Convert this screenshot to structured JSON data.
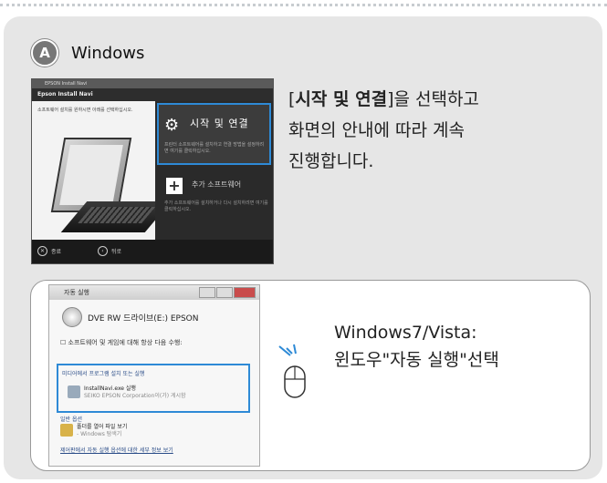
{
  "header": {
    "badge": "A",
    "title": "Windows"
  },
  "navi": {
    "window_title": "EPSON Install Navi",
    "app_title": "Epson Install Navi",
    "left_text": "소프트웨어 설치를 원하시면 아래를 선택하십시오.",
    "option1_label": "시작 및 연결",
    "option1_desc": "프린터 소프트웨어를 설치하고 연결 방법을 설정하려면 여기를 클릭하십시오.",
    "option2_label": "추가 소프트웨어",
    "option2_desc": "추가 소프트웨어를 설치하거나 다시 설치하려면 여기를 클릭하십시오.",
    "footer_left": "종료",
    "footer_right": "뒤로"
  },
  "instruction": {
    "bold_part": "시작 및 연결",
    "line1_suffix": "]을 선택하고",
    "line2": "화면의 안내에 따라 계속",
    "line3": "진행합니다."
  },
  "autoplay": {
    "title": "자동 실행",
    "drive_label": "DVE RW 드라이브(E:) EPSON",
    "checkbox_label": "소프트웨어 및 게임에 대해 항상 다음 수행:",
    "section1": "미디어에서 프로그램 설치 또는 실행",
    "item1_title": "InstallNavi.exe 실행",
    "item1_sub": "SEIKO EPSON Corporation이(가) 게시함",
    "section2": "일반 옵션",
    "item2_title": "폴더를 열어 파일 보기",
    "item2_sub": "- Windows 탐색기",
    "link": "제어판에서 자동 실행 옵션에 대한 세부 정보 보기"
  },
  "inner": {
    "line1": "Windows7/Vista:",
    "line2": "윈도우\"자동 실행\"선택"
  },
  "colors": {
    "highlight": "#2e8ad6",
    "panel": "#e6e6e6"
  }
}
